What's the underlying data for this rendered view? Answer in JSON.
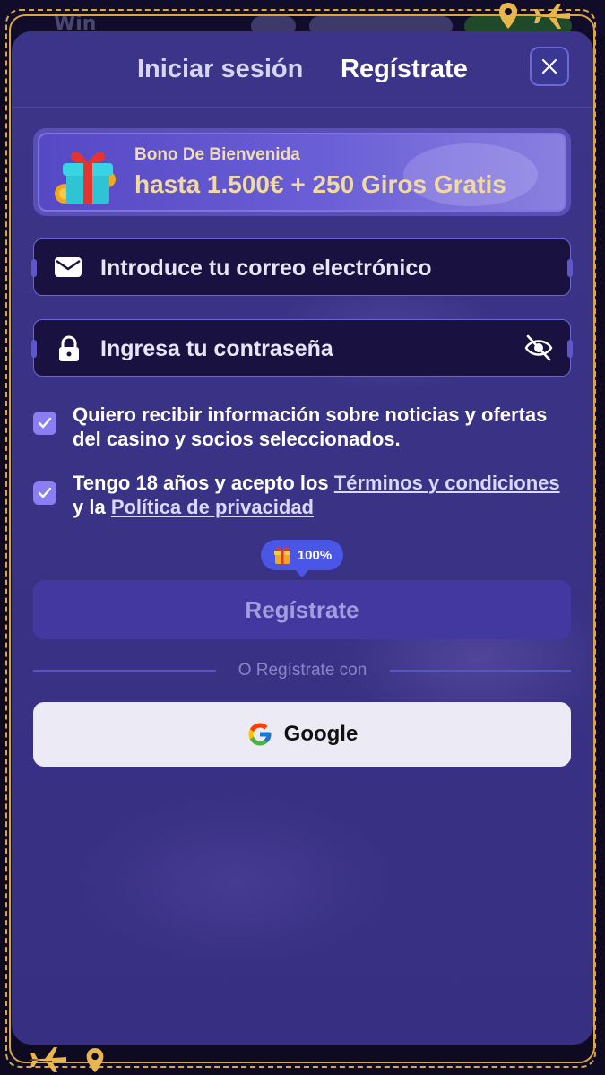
{
  "background": {
    "brand_text": "Win"
  },
  "tabs": {
    "login": "Iniciar sesión",
    "register": "Regístrate"
  },
  "bonus": {
    "title": "Bono De Bienvenida",
    "amount": "hasta 1.500€ + 250 Giros Gratis"
  },
  "form": {
    "email_placeholder": "Introduce tu correo electrónico",
    "password_placeholder": "Ingresa tu contraseña",
    "consent_news": "Quiero recibir información sobre noticias y ofertas del casino y socios seleccionados.",
    "age_prefix": "Tengo 18 años y acepto los ",
    "terms_link": "Términos y condiciones",
    "age_middle": "y la ",
    "privacy_link": "Política de privacidad",
    "bonus_progress": "100%",
    "submit_label": "Regístrate",
    "or_text": "O Regístrate con",
    "google_label": "Google"
  },
  "colors": {
    "modal_bg": "#3a3285",
    "accent": "#8a7ef2",
    "gold": "#d9a640",
    "badge": "#4a56e6"
  },
  "icons": [
    "close-icon",
    "gift-icon",
    "mail-icon",
    "lock-icon",
    "eye-off-icon",
    "check-icon",
    "google-icon",
    "airplane-icon",
    "location-pin-icon"
  ]
}
